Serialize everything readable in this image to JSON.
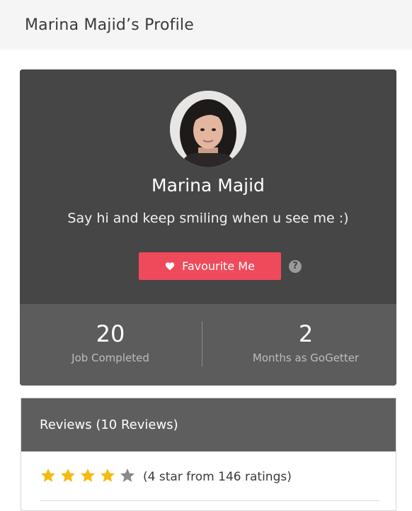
{
  "header": {
    "title": "Marina Majid’s Profile"
  },
  "profile": {
    "name": "Marina Majid",
    "tagline": "Say hi and keep smiling when u see me :)",
    "favourite_label": "Favourite Me",
    "help_symbol": "?",
    "stats": [
      {
        "value": "20",
        "label": "Job Completed"
      },
      {
        "value": "2",
        "label": "Months as GoGetter"
      }
    ]
  },
  "reviews": {
    "title": "Reviews (10 Reviews)",
    "rating": 4,
    "max_rating": 5,
    "rating_text": "(4 star from 146 ratings)"
  },
  "colors": {
    "accent_red": "#ef4a5b",
    "star_filled": "#f6b90f",
    "star_empty": "#8a8a8a",
    "card_dark": "#464646",
    "stats_bg": "#5c5c5c"
  }
}
